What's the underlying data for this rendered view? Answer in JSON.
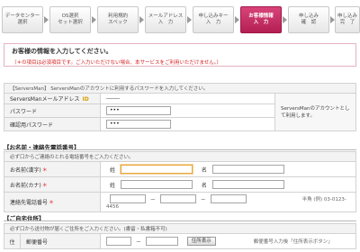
{
  "steps": [
    {
      "label": "データセンター\n選択",
      "active": false
    },
    {
      "label": "OS選択\nセット選択",
      "active": false
    },
    {
      "label": "利用規約\nスペック",
      "active": false
    },
    {
      "label": "メールアドレス\n入　力",
      "active": false
    },
    {
      "label": "申し込みキー\n入　力",
      "active": false
    },
    {
      "label": "お客様情報\n入　力",
      "active": true
    },
    {
      "label": "申し込み\n確　認",
      "active": false
    },
    {
      "label": "申し込み\n完　了",
      "active": false
    }
  ],
  "intro": {
    "title": "お客様の情報を入力してください。",
    "warning": "（＊の項目は必須項目です。ご入力いただけない場合、本サービスをご利用いただけません。）"
  },
  "account": {
    "header": "【ServersMan】 ServersManのアカウントに利用するパスワードを入力してください。",
    "email_label": "ServersManメールアドレス",
    "email_value": "━━━━━",
    "password_label": "パスワード",
    "password_value": "•••",
    "confirm_label": "確認用パスワード",
    "confirm_value": "•••",
    "side_note": "ServersManのアカウントとして利用します。"
  },
  "name_section": {
    "title": "【お名前・連絡先電話番号】",
    "note": "必ず口からご連絡のとれる電話番号をご入力ください。",
    "kanji_label": "お名前(漢字)",
    "kana_label": "お名前(カナ)",
    "phone_label": "連絡先電話番号",
    "sei": "姓",
    "mei": "名",
    "required_mark": "＊",
    "phone_example": "半角 (例) 03-0123-4456"
  },
  "address_section": {
    "title": "【ご自宅住所】",
    "note": "必ず口から送付物が届くご住所をご入力ください。(書留・私書箱不可)",
    "row_label": "住",
    "zip_label": "郵便番号",
    "zip_button": "住所表示",
    "zip_side": "郵便番号入力後「住所表示ボタン」"
  }
}
